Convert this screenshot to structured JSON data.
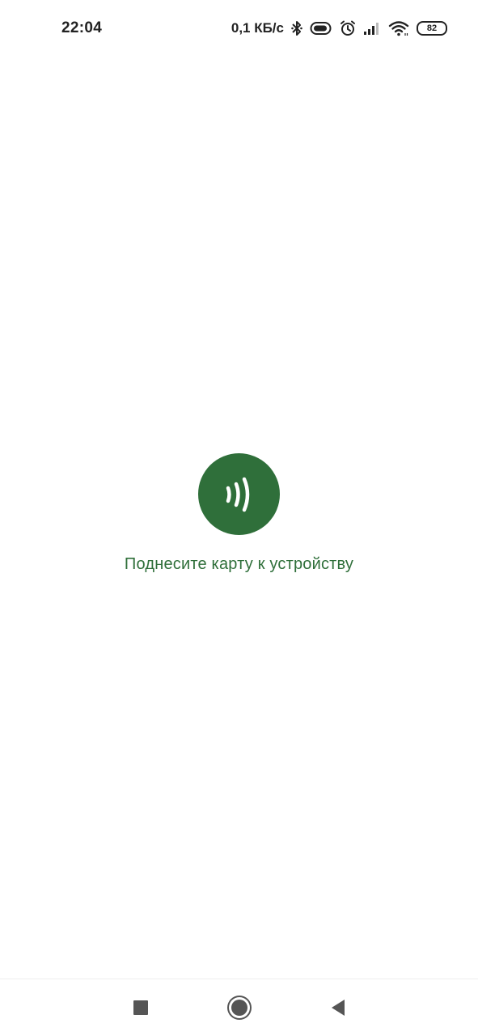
{
  "status_bar": {
    "time": "22:04",
    "net_speed": "0,1 КБ/с",
    "battery_level": "82",
    "icons": [
      "bluetooth-icon",
      "vpn-key-icon",
      "alarm-icon",
      "signal-icon",
      "wifi-icon",
      "battery-icon"
    ]
  },
  "main": {
    "nfc_icon": "nfc-contactless-icon",
    "prompt_text": "Поднесите карту к устройству"
  },
  "nav_bar": {
    "buttons": [
      "recent-apps",
      "home",
      "back"
    ]
  },
  "colors": {
    "accent": "#2f6f3a",
    "text_dark": "#222222",
    "nav_icon": "#555555",
    "background": "#ffffff"
  }
}
